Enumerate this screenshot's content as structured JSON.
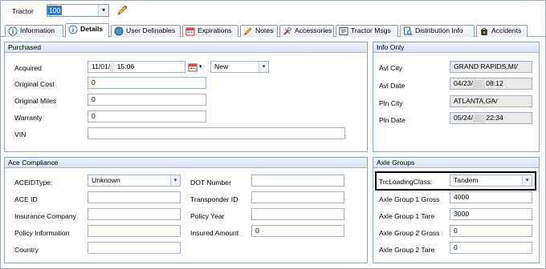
{
  "top": {
    "tractor_label": "Tractor",
    "tractor_value": "100"
  },
  "tabs": [
    {
      "label": "Information"
    },
    {
      "label": "Details"
    },
    {
      "label": "User Definables"
    },
    {
      "label": "Expirations"
    },
    {
      "label": "Notes"
    },
    {
      "label": "Accessories"
    },
    {
      "label": "Tractor Msgs"
    },
    {
      "label": "Distribution Info"
    },
    {
      "label": "Accidents"
    }
  ],
  "purchased": {
    "title": "Purchased",
    "acquired_label": "Acquired",
    "acquired_date": "11/01/",
    "acquired_time": "15:06",
    "acquired_status": "New",
    "original_cost_label": "Original Cost",
    "original_cost": "0",
    "original_miles_label": "Original Miles",
    "original_miles": "0",
    "warranty_label": "Warranty",
    "warranty": "0",
    "vin_label": "VIN",
    "vin": ""
  },
  "info_only": {
    "title": "Info Only",
    "avl_city_label": "Avl City",
    "avl_city": "GRAND RAPIDS,MI/",
    "avl_date_label": "Avl Date",
    "avl_date": "04/23/",
    "avl_time": "08:12",
    "pln_city_label": "Pln City",
    "pln_city": "ATLANTA,GA/",
    "pln_date_label": "Pln Date",
    "pln_date": "05/24/",
    "pln_time": "22:34"
  },
  "ace": {
    "title": "Ace Compliance",
    "aceid_type_label": "ACEIDType:",
    "aceid_type": "Unknown",
    "ace_id_label": "ACE ID",
    "ace_id": "",
    "insurance_company_label": "Insurance Company",
    "insurance_company": "",
    "policy_information_label": "Policy Information",
    "policy_information": "",
    "country_label": "Country",
    "country": "",
    "dot_number_label": "DOT Number",
    "dot_number": "",
    "transponder_id_label": "Transponder ID",
    "transponder_id": "",
    "policy_year_label": "Policy Year",
    "policy_year": "",
    "insured_amount_label": "Insured Amount",
    "insured_amount": "0"
  },
  "axle": {
    "title": "Axle Groups",
    "trc_loading_class_label": "TrcLoadingClass:",
    "trc_loading_class": "Tandem",
    "g1_gross_label": "Axle Group 1 Gross",
    "g1_gross": "4000",
    "g1_tare_label": "Axle Group 1 Tare",
    "g1_tare": "3000",
    "g2_gross_label": "Axle Group 2 Gross",
    "g2_gross": "0",
    "g2_tare_label": "Axle Group 2 Tare",
    "g2_tare": "0"
  }
}
